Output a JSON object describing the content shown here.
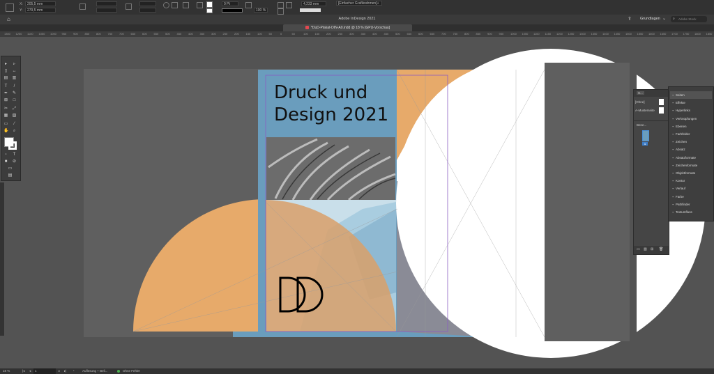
{
  "app": {
    "title": "Adobe InDesign 2021",
    "workspace_label": "Grundlagen",
    "search_placeholder": "Adobe Stock"
  },
  "document": {
    "tab_label": "*DuD-Plakat-DIN-A0.indd @ 18 % [GPU-Vorschau]"
  },
  "control_bar": {
    "x_value": "205,5 mm",
    "y_value": "279,5 mm",
    "stroke_weight": "0 Pt",
    "scale_value": "100 %",
    "dimension_value": "4,233 mm",
    "frame_style": "[Einfacher Grafikrahmen]+"
  },
  "ruler": {
    "ticks": [
      "1300",
      "1250",
      "1100",
      "1050",
      "1000",
      "950",
      "900",
      "850",
      "800",
      "750",
      "700",
      "650",
      "600",
      "550",
      "500",
      "450",
      "400",
      "350",
      "300",
      "250",
      "200",
      "150",
      "100",
      "50",
      "0",
      "50",
      "100",
      "150",
      "200",
      "250",
      "300",
      "350",
      "400",
      "450",
      "500",
      "550",
      "600",
      "650",
      "700",
      "750",
      "800",
      "850",
      "900",
      "950",
      "1000",
      "1050",
      "1100",
      "1150",
      "1200",
      "1250",
      "1300",
      "1350",
      "1400",
      "1450",
      "1500",
      "1550",
      "1600",
      "1650",
      "1700",
      "1750",
      "1800",
      "1850"
    ]
  },
  "poster": {
    "headline_line1": "Druck und",
    "headline_line2": "Design 2021",
    "colors": {
      "blue": "#6a9dbd",
      "orange": "#e7aa6a",
      "gray_overlap": "#8a8b96",
      "white": "#ffffff"
    }
  },
  "pages_panel": {
    "tab_label": "S...",
    "none_label": "[Ohne]",
    "master_label": "A-Musterseite",
    "section_label": "Bene...",
    "page_number": "1"
  },
  "side_panel": {
    "items": [
      {
        "icon": "pages-icon",
        "label": "Seiten"
      },
      {
        "icon": "fx-icon",
        "label": "Effekte"
      },
      {
        "icon": "hyperlinks-icon",
        "label": "Hyperlinks"
      },
      {
        "icon": "links-icon",
        "label": "Verknüpfungen"
      },
      {
        "icon": "layers-icon",
        "label": "Ebenen"
      },
      {
        "icon": "swatches-icon",
        "label": "Farbfelder"
      },
      {
        "icon": "character-icon",
        "label": "Zeichen"
      },
      {
        "icon": "paragraph-icon",
        "label": "Absatz"
      },
      {
        "icon": "paragraph-styles-icon",
        "label": "Absatzformate"
      },
      {
        "icon": "character-styles-icon",
        "label": "Zeichenformate"
      },
      {
        "icon": "object-styles-icon",
        "label": "Objektformate"
      },
      {
        "icon": "stroke-icon",
        "label": "Kontur"
      },
      {
        "icon": "gradient-icon",
        "label": "Verlauf"
      },
      {
        "icon": "color-icon",
        "label": "Farbe"
      },
      {
        "icon": "pathfinder-icon",
        "label": "Pathfinder"
      },
      {
        "icon": "text-wrap-icon",
        "label": "Textumfluss"
      }
    ]
  },
  "status_bar": {
    "zoom": "18 %",
    "page": "1",
    "preflight_profile": "Auflösung + Beli...",
    "error_status": "Ohne Fehler"
  }
}
